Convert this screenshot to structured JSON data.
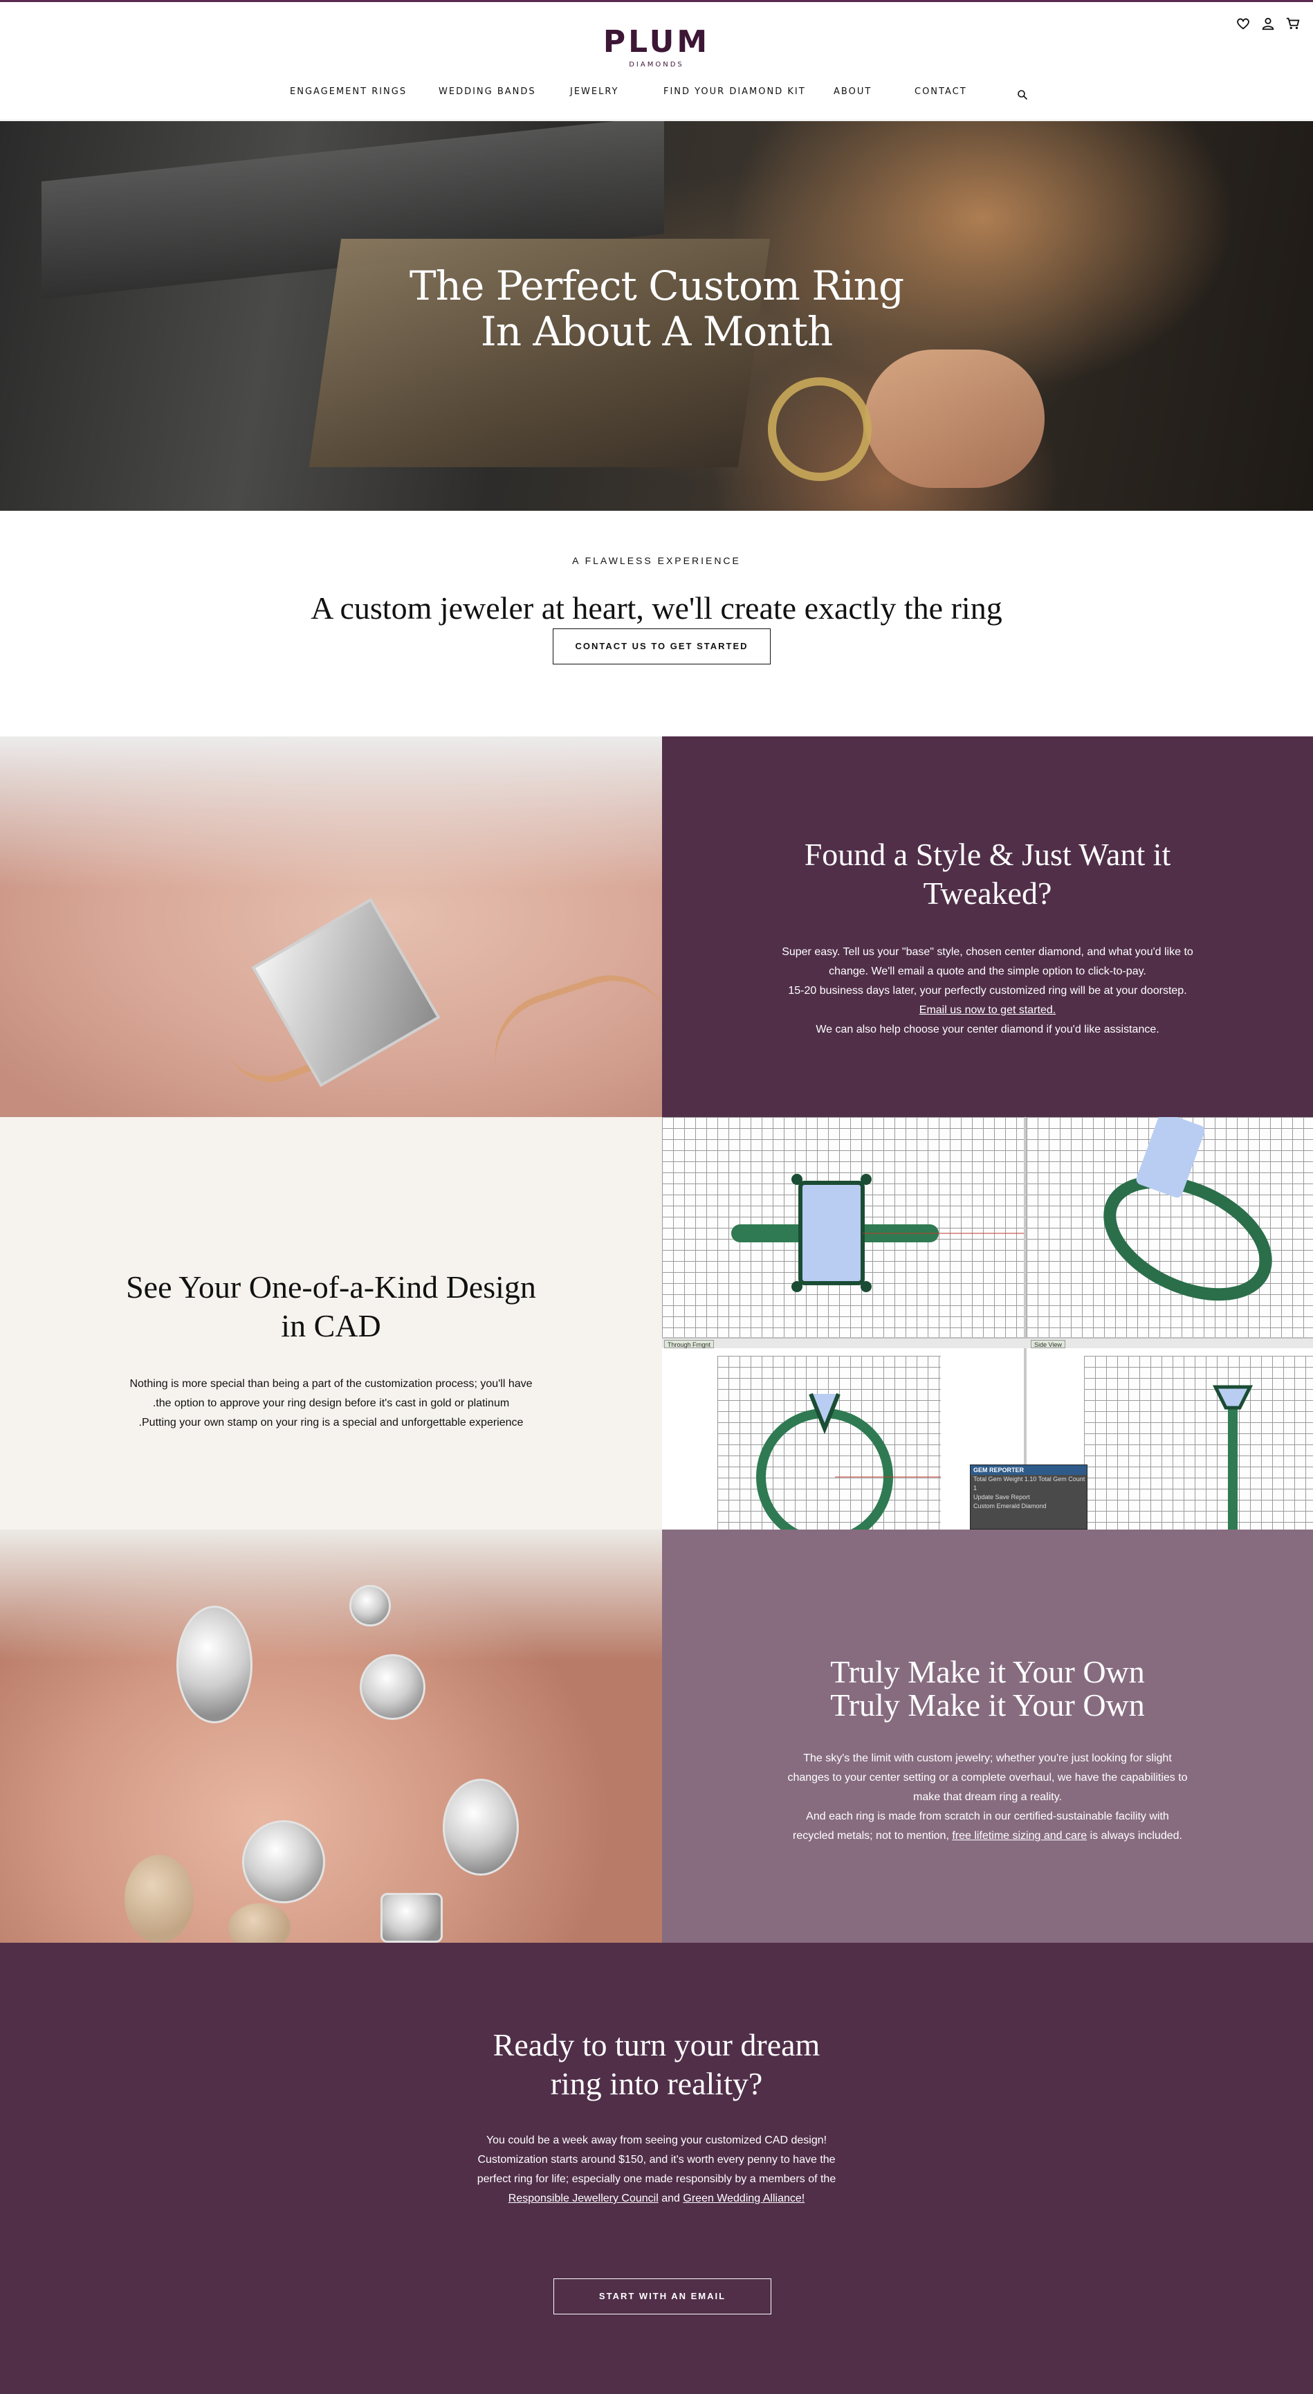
{
  "brand": {
    "name": "PLUM",
    "subtitle": "DIAMONDS",
    "accent": "#512f49",
    "accent_light": "#876c80"
  },
  "header": {
    "icons": [
      "heart-icon",
      "user-icon",
      "cart-icon"
    ],
    "nav": [
      "ENGAGEMENT RINGS",
      "WEDDING BANDS",
      "JEWELRY",
      "FIND YOUR DIAMOND KIT",
      "ABOUT",
      "CONTACT"
    ],
    "search_icon": "search-icon"
  },
  "hero": {
    "line1": "The Perfect Custom Ring",
    "line2": "In About A Month"
  },
  "intro": {
    "eyebrow": "A FLAWLESS EXPERIENCE",
    "heading": "A custom jeweler at heart, we'll create exactly the ring",
    "button": "CONTACT US TO GET STARTED"
  },
  "tweak": {
    "title_line1": "Found a Style & Just Want it",
    "title_line2": "Tweaked?",
    "p1": "Super easy. Tell us your \"base\" style, chosen center diamond, and what you'd like to",
    "p2": "change. We'll email a quote and the simple option to click-to-pay.",
    "p3": "15-20 business days later, your perfectly customized ring will be at your doorstep.",
    "link": "Email us now to get started.",
    "p4": "We can also help choose your center diamond if you'd like assistance."
  },
  "cad": {
    "title_line1": "See Your One-of-a-Kind Design",
    "title_line2": "in CAD",
    "p1": "Nothing is more special than being a part of the customization process; you'll have",
    "p2": ".the option to approve your ring design before it's cast in gold or platinum",
    "p3": ".Putting your own stamp on your ring is a special and unforgettable experience",
    "viewport_tab1": "Through Frngnt",
    "viewport_tab2": "Side View",
    "gem_panel_title": "GEM REPORTER",
    "gem_row1_label": "Total Gem Weight",
    "gem_row1_value": "1.10",
    "gem_row1_label2": "Total Gem Count",
    "gem_row1_value2": "1",
    "gem_row2_update": "Update",
    "gem_row2_save": "Save Report",
    "gem_row3_a": "Custom Emerald",
    "gem_row3_b": "Diamond"
  },
  "own": {
    "title_line1": "Truly Make it Your Own",
    "title_line2": "Truly Make it Your Own",
    "p1": "The sky's the limit with custom jewelry; whether you're just looking for slight",
    "p2": "changes to your center setting or a complete overhaul, we have the capabilities to",
    "p3": "make that dream ring a reality.",
    "p4": "And each ring is made from scratch in our certified-sustainable facility with",
    "p5_start": "recycled metals; not to mention,",
    "p5_link": "free lifetime sizing and care",
    "p5_end": "is always included."
  },
  "cta": {
    "title_line1": "Ready to turn your dream",
    "title_line2": "ring into reality?",
    "p1": "You could be a week away from seeing your customized CAD design!",
    "p2": "Customization starts around $150, and it's worth every penny to have the",
    "p3": "perfect ring for life; especially one made responsibly by a members of the",
    "link1": "Responsible Jewellery Council",
    "and": "and",
    "link2": "Green Wedding Alliance!",
    "button": "START WITH AN EMAIL"
  }
}
